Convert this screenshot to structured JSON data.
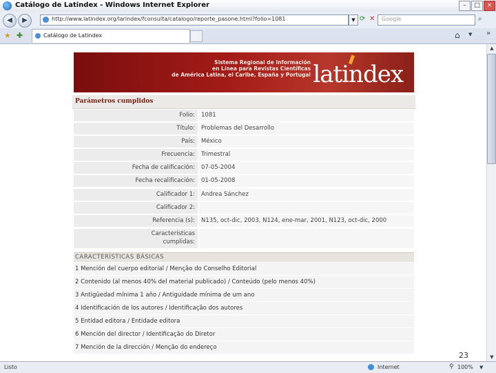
{
  "window": {
    "title": "Catálogo de Latindex - Windows Internet Explorer"
  },
  "address": {
    "url": "http://www.latindex.org/larindex/fconsulta/catalogo/reporte_pasone.html?folio=1081",
    "search_placeholder": "Google"
  },
  "tab": {
    "label": "Catálogo de Latindex"
  },
  "banner": {
    "line1": "Sistema Regional de Información",
    "line2": "en Línea para Revistas Científicas",
    "line3": "de América Latina, el Caribe, España y Portugal",
    "logo": "latindex"
  },
  "section": {
    "title": "Parámetros cumplidos"
  },
  "fields": [
    {
      "label": "Folio:",
      "value": "1081"
    },
    {
      "label": "Título:",
      "value": "Problemas del Desarrollo"
    },
    {
      "label": "País:",
      "value": "México"
    },
    {
      "label": "Frecuencia:",
      "value": "Trimestral"
    },
    {
      "label": "Fecha de calificación:",
      "value": "07-05-2004"
    },
    {
      "label": "Fecha recalificación:",
      "value": "01-05-2008"
    },
    {
      "label": "Calificador 1:",
      "value": "Andrea Sánchez"
    },
    {
      "label": "Calificador 2:",
      "value": ""
    },
    {
      "label": "Referencia (s):",
      "value": "N135, oct-dic, 2003, N124, ene-mar, 2001, N123, oct-dic, 2000"
    }
  ],
  "characteristics_label": {
    "line1": "Características",
    "line2": "cumplidas:"
  },
  "characteristics_head": "CARACTERÍSTICAS BÁSICAS",
  "criteria": [
    "1 Mención del cuerpo editorial / Menção do Conselho Editorial",
    "2 Contenido (al menos 40% del material publicado) / Conteúdo (pelo menos 40%)",
    "3 Antigüedad mínima 1 año / Antiguidade mínima de um ano",
    "4 Identificación de los autores / Identificação dos autores",
    "5 Entidad editora / Entidade editora",
    "6 Mención del director / Identificação do Diretor",
    "7 Mención de la dirección / Menção do endereço"
  ],
  "status": {
    "text": "Listo",
    "zone": "Internet",
    "zoom": "100%"
  },
  "page_number": "23"
}
